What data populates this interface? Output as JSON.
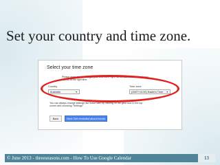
{
  "slide": {
    "title": "Set your country and time zone."
  },
  "dialog": {
    "title": "Select your time zone",
    "notice_line1": "Please make sure we've got your time zone right, so we can remind about your",
    "notice_line2": "events at the right time.",
    "country_label": "Country",
    "country_value": "Australia",
    "timezone_label": "Time zone",
    "timezone_value": "(GMT+10:00) Eastern Time",
    "help_line1": "You can always change settings like these later by clicking on the gear icon in the top",
    "help_line2": "corner and choosing \"Settings\"",
    "back_button": "Back",
    "next_button": "Next: Get reminded about events"
  },
  "footer": {
    "text": "© June 2013 - threeseasons.com - How To Use Google Calendar",
    "page_number": "13",
    "bar_color": "#4f8499"
  },
  "colors": {
    "highlight": "#e0201c",
    "primary_button": "#4a84ee"
  }
}
